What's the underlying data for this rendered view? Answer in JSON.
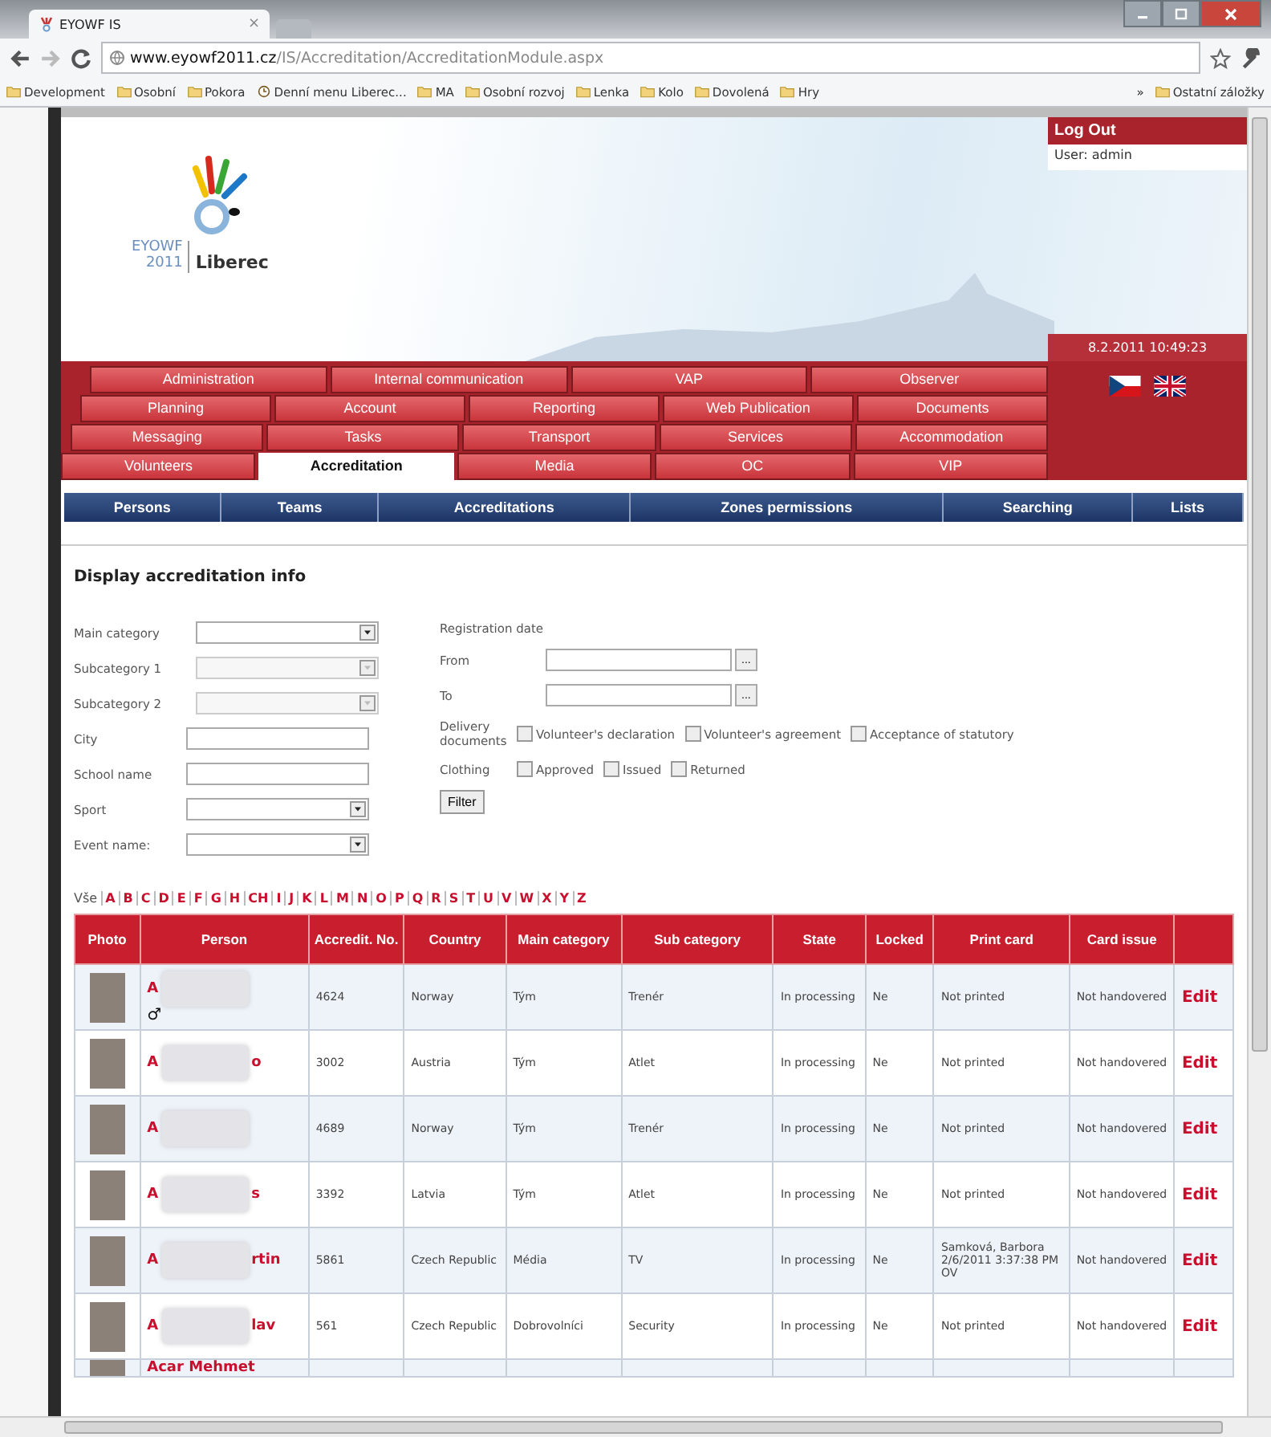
{
  "browser": {
    "tab_title": "EYOWF IS",
    "tab_close": "×",
    "url_host": "www.eyowf2011.cz",
    "url_path": "/IS/Accreditation/AccreditationModule.aspx",
    "bookmarks": [
      {
        "label": "Development",
        "kind": "folder"
      },
      {
        "label": "Osobní",
        "kind": "folder"
      },
      {
        "label": "Pokora",
        "kind": "folder"
      },
      {
        "label": "Denní menu Liberec...",
        "kind": "page"
      },
      {
        "label": "MA",
        "kind": "folder"
      },
      {
        "label": "Osobní rozvoj",
        "kind": "folder"
      },
      {
        "label": "Lenka",
        "kind": "folder"
      },
      {
        "label": "Kolo",
        "kind": "folder"
      },
      {
        "label": "Dovolená",
        "kind": "folder"
      },
      {
        "label": "Hry",
        "kind": "folder"
      }
    ],
    "overflow": "»",
    "other_bookmarks": "Ostatní záložky"
  },
  "header": {
    "logo_code": "EYOWF",
    "logo_year": "2011",
    "logo_city": "Liberec",
    "logout": "Log Out",
    "user": "User: admin",
    "datetime": "8.2.2011 10:49:23"
  },
  "main_tabs": [
    [
      {
        "label": "Administration",
        "selected": false
      },
      {
        "label": "Internal communication",
        "selected": false
      },
      {
        "label": "VAP",
        "selected": false
      },
      {
        "label": "Observer",
        "selected": false
      }
    ],
    [
      {
        "label": "Planning",
        "selected": false
      },
      {
        "label": "Account",
        "selected": false
      },
      {
        "label": "Reporting",
        "selected": false
      },
      {
        "label": "Web Publication",
        "selected": false
      },
      {
        "label": "Documents",
        "selected": false
      }
    ],
    [
      {
        "label": "Messaging",
        "selected": false
      },
      {
        "label": "Tasks",
        "selected": false
      },
      {
        "label": "Transport",
        "selected": false
      },
      {
        "label": "Services",
        "selected": false
      },
      {
        "label": "Accommodation",
        "selected": false
      }
    ],
    [
      {
        "label": "Volunteers",
        "selected": false
      },
      {
        "label": "Accreditation",
        "selected": true
      },
      {
        "label": "Media",
        "selected": false
      },
      {
        "label": "OC",
        "selected": false
      },
      {
        "label": "VIP",
        "selected": false
      }
    ]
  ],
  "sub_nav": [
    "Persons",
    "Teams",
    "Accreditations",
    "Zones permissions",
    "Searching",
    "Lists"
  ],
  "section_title": "Display accreditation info",
  "filters_left": [
    {
      "label": "Main category",
      "kind": "select",
      "disabled": false
    },
    {
      "label": "Subcategory 1",
      "kind": "select",
      "disabled": true
    },
    {
      "label": "Subcategory 2",
      "kind": "select",
      "disabled": true
    },
    {
      "label": "City",
      "kind": "text",
      "disabled": false
    },
    {
      "label": "School name",
      "kind": "text",
      "disabled": false
    },
    {
      "label": "Sport",
      "kind": "select",
      "disabled": false
    },
    {
      "label": "Event name:",
      "kind": "select",
      "disabled": false
    }
  ],
  "registration": {
    "title": "Registration date",
    "from": "From",
    "to": "To",
    "picker": "..."
  },
  "checkbox_groups": [
    {
      "label": "Delivery documents",
      "options": [
        {
          "label": "Volunteer's declaration",
          "checked": false
        },
        {
          "label": "Volunteer's agreement",
          "checked": false
        },
        {
          "label": "Acceptance of statutory",
          "checked": false
        }
      ]
    },
    {
      "label": "Clothing",
      "options": [
        {
          "label": "Approved",
          "checked": false
        },
        {
          "label": "Issued",
          "checked": false
        },
        {
          "label": "Returned",
          "checked": false
        }
      ]
    }
  ],
  "filter_button": "Filter",
  "alphabet": [
    "Vše",
    "A",
    "B",
    "C",
    "D",
    "E",
    "F",
    "G",
    "H",
    "CH",
    "I",
    "J",
    "K",
    "L",
    "M",
    "N",
    "O",
    "P",
    "Q",
    "R",
    "S",
    "T",
    "U",
    "V",
    "W",
    "X",
    "Y",
    "Z"
  ],
  "table": {
    "columns": [
      "Photo",
      "Person",
      "Accredit. No.",
      "Country",
      "Main category",
      "Sub category",
      "State",
      "Locked",
      "Print card",
      "Card issue"
    ],
    "rows": [
      {
        "name_start": "A",
        "name_end": "",
        "gender": "♂",
        "accredit": "4624",
        "country": "Norway",
        "main": "Tým",
        "sub": "Trenér",
        "state": "In processing",
        "locked": "Ne",
        "print": "Not printed",
        "print_note": "",
        "issue": "Not handovered",
        "action": "Edit"
      },
      {
        "name_start": "A",
        "name_end": "o",
        "gender": "",
        "accredit": "3002",
        "country": "Austria",
        "main": "Tým",
        "sub": "Atlet",
        "state": "In processing",
        "locked": "Ne",
        "print": "Not printed",
        "print_note": "",
        "issue": "Not handovered",
        "action": "Edit"
      },
      {
        "name_start": "A",
        "name_end": "",
        "gender": "",
        "accredit": "4689",
        "country": "Norway",
        "main": "Tým",
        "sub": "Trenér",
        "state": "In processing",
        "locked": "Ne",
        "print": "Not printed",
        "print_note": "",
        "issue": "Not handovered",
        "action": "Edit"
      },
      {
        "name_start": "A",
        "name_end": "s",
        "gender": "",
        "accredit": "3392",
        "country": "Latvia",
        "main": "Tým",
        "sub": "Atlet",
        "state": "In processing",
        "locked": "Ne",
        "print": "Not printed",
        "print_note": "",
        "issue": "Not handovered",
        "action": "Edit"
      },
      {
        "name_start": "A",
        "name_end": "rtin",
        "gender": "",
        "accredit": "5861",
        "country": "Czech Republic",
        "main": "Média",
        "sub": "TV",
        "state": "In processing",
        "locked": "Ne",
        "print": "Samková, Barbora 2/6/2011 3:37:38 PM",
        "print_note": "OV",
        "issue": "Not handovered",
        "action": "Edit"
      },
      {
        "name_start": "A",
        "name_end": "lav",
        "gender": "",
        "accredit": "561",
        "country": "Czech Republic",
        "main": "Dobrovolníci",
        "sub": "Security",
        "state": "In processing",
        "locked": "Ne",
        "print": "Not printed",
        "print_note": "",
        "issue": "Not handovered",
        "action": "Edit"
      }
    ],
    "partial_row_person": "Acar Mehmet"
  }
}
